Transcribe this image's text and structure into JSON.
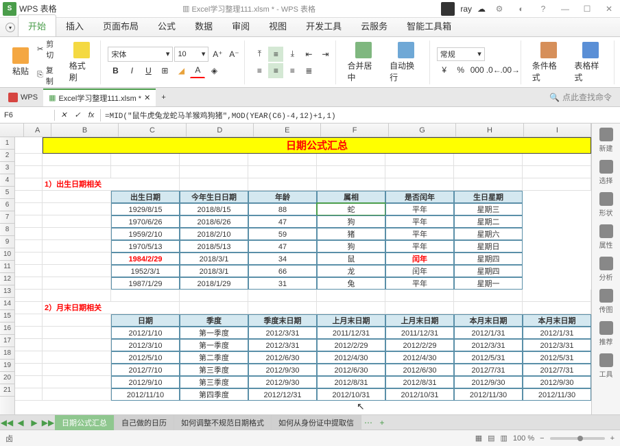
{
  "app": {
    "logo": "S",
    "name": "WPS 表格",
    "docname": "Excel学习整理111.xlsm * - WPS 表格",
    "user": "ray"
  },
  "winbtns": {
    "settings": "⚙",
    "skin": "◐",
    "help": "?",
    "min": "—",
    "max": "☐",
    "close": "✕"
  },
  "menu": {
    "items": [
      "开始",
      "插入",
      "页面布局",
      "公式",
      "数据",
      "审阅",
      "视图",
      "开发工具",
      "云服务",
      "智能工具箱"
    ],
    "active": 0
  },
  "ribbon": {
    "paste": "粘贴",
    "cut": "剪切",
    "copy": "复制",
    "fmtpaint": "格式刷",
    "font": "宋体",
    "size": "10",
    "merge": "合并居中",
    "wrap": "自动换行",
    "numfmt": "常规",
    "condfmt": "条件格式",
    "tablestyle": "表格样式"
  },
  "doctabs": {
    "wps": "WPS",
    "file": "Excel学习整理111.xlsm *",
    "search": "点此查找命令"
  },
  "namebox": "F6",
  "formula": "=MID(\"鼠牛虎兔龙蛇马羊猴鸡狗猪\",MOD(YEAR(C6)-4,12)+1,1)",
  "cols": [
    "B",
    "C",
    "D",
    "E",
    "F",
    "G",
    "H",
    "I"
  ],
  "widths": [
    40,
    100,
    100,
    100,
    100,
    100,
    100,
    100,
    100
  ],
  "banner": "日期公式汇总",
  "sec1": {
    "title": "1）出生日期相关",
    "heads": [
      "出生日期",
      "今年生日日期",
      "年龄",
      "属相",
      "是否闰年",
      "生日星期"
    ],
    "rows": [
      [
        "1929/8/15",
        "2018/8/15",
        "88",
        "蛇",
        "平年",
        "星期三"
      ],
      [
        "1970/6/26",
        "2018/6/26",
        "47",
        "狗",
        "平年",
        "星期二"
      ],
      [
        "1959/2/10",
        "2018/2/10",
        "59",
        "猪",
        "平年",
        "星期六"
      ],
      [
        "1970/5/13",
        "2018/5/13",
        "47",
        "狗",
        "平年",
        "星期日"
      ],
      [
        "1984/2/29",
        "2018/3/1",
        "34",
        "鼠",
        "闰年",
        "星期四"
      ],
      [
        "1952/3/1",
        "2018/3/1",
        "66",
        "龙",
        "闰年",
        "星期四"
      ],
      [
        "1987/1/29",
        "2018/1/29",
        "31",
        "兔",
        "平年",
        "星期一"
      ]
    ]
  },
  "sec2": {
    "title": "2）月末日期相关",
    "heads": [
      "日期",
      "季度",
      "季度末日期",
      "上月末日期",
      "上月末日期",
      "本月末日期",
      "本月末日期"
    ],
    "rows": [
      [
        "2012/1/10",
        "第一季度",
        "2012/3/31",
        "2011/12/31",
        "2011/12/31",
        "2012/1/31",
        "2012/1/31"
      ],
      [
        "2012/3/10",
        "第一季度",
        "2012/3/31",
        "2012/2/29",
        "2012/2/29",
        "2012/3/31",
        "2012/3/31"
      ],
      [
        "2012/5/10",
        "第二季度",
        "2012/6/30",
        "2012/4/30",
        "2012/4/30",
        "2012/5/31",
        "2012/5/31"
      ],
      [
        "2012/7/10",
        "第三季度",
        "2012/9/30",
        "2012/6/30",
        "2012/6/30",
        "2012/7/31",
        "2012/7/31"
      ],
      [
        "2012/9/10",
        "第三季度",
        "2012/9/30",
        "2012/8/31",
        "2012/8/31",
        "2012/9/30",
        "2012/9/30"
      ],
      [
        "2012/11/10",
        "第四季度",
        "2012/12/31",
        "2012/10/31",
        "2012/10/31",
        "2012/11/30",
        "2012/11/30"
      ]
    ]
  },
  "sheets": [
    "日期公式汇总",
    "自己做的日历",
    "如何调整不规范日期格式",
    "如何从身份证中提取信"
  ],
  "side": [
    "新建",
    "选择",
    "形状",
    "属性",
    "分析",
    "传图",
    "推荐",
    "工具"
  ],
  "zoom": "100 %",
  "status_icon": "卤"
}
